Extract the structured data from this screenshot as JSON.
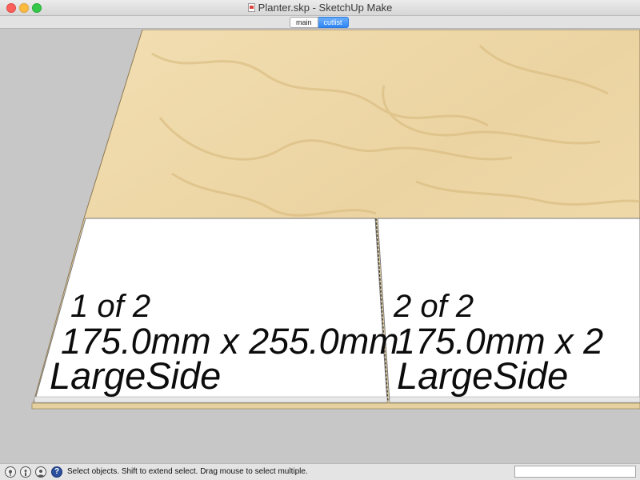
{
  "window": {
    "title": "Planter.skp - SketchUp Make"
  },
  "scene_tabs": [
    {
      "label": "main",
      "active": false
    },
    {
      "label": "cutlist",
      "active": true
    }
  ],
  "viewport": {
    "parts": [
      {
        "line1": "1 of 2",
        "line2": "175.0mm x 255.0mm",
        "line3": "LargeSide"
      },
      {
        "line1": "2 of 2",
        "line2": "175.0mm x 2",
        "line3": "LargeSide"
      }
    ]
  },
  "statusbar": {
    "message": "Select objects. Shift to extend select. Drag mouse to select multiple.",
    "measurements_value": "",
    "icons": [
      "geolocation-icon",
      "credits-icon",
      "user-icon",
      "help-icon"
    ]
  },
  "colors": {
    "accent": "#2f86f4",
    "wood": "#ecd6a6",
    "background": "#c7c7c7"
  }
}
